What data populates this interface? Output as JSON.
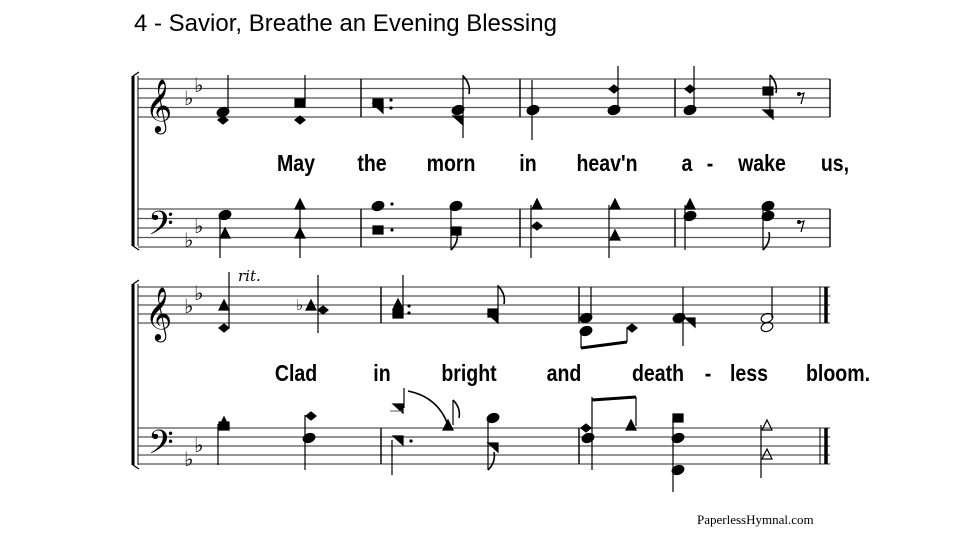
{
  "title": "4 - Savior, Breathe an Evening Blessing",
  "footer": "PaperlessHymnal.com",
  "key_signature": "B-flat major (2 flats)",
  "systems": [
    {
      "lyrics": [
        "May",
        "the",
        "morn",
        "in",
        "heav'n",
        "a",
        "-",
        "wake",
        "us,"
      ],
      "tempo_marking": ""
    },
    {
      "lyrics": [
        "Clad",
        "in",
        "bright",
        "and",
        "death",
        "-",
        "less",
        "bloom."
      ],
      "tempo_marking": "rit."
    }
  ],
  "icons": {
    "treble_clef": "𝄞",
    "bass_clef": "𝄢",
    "flat": "♭",
    "rest": "𝄾"
  }
}
